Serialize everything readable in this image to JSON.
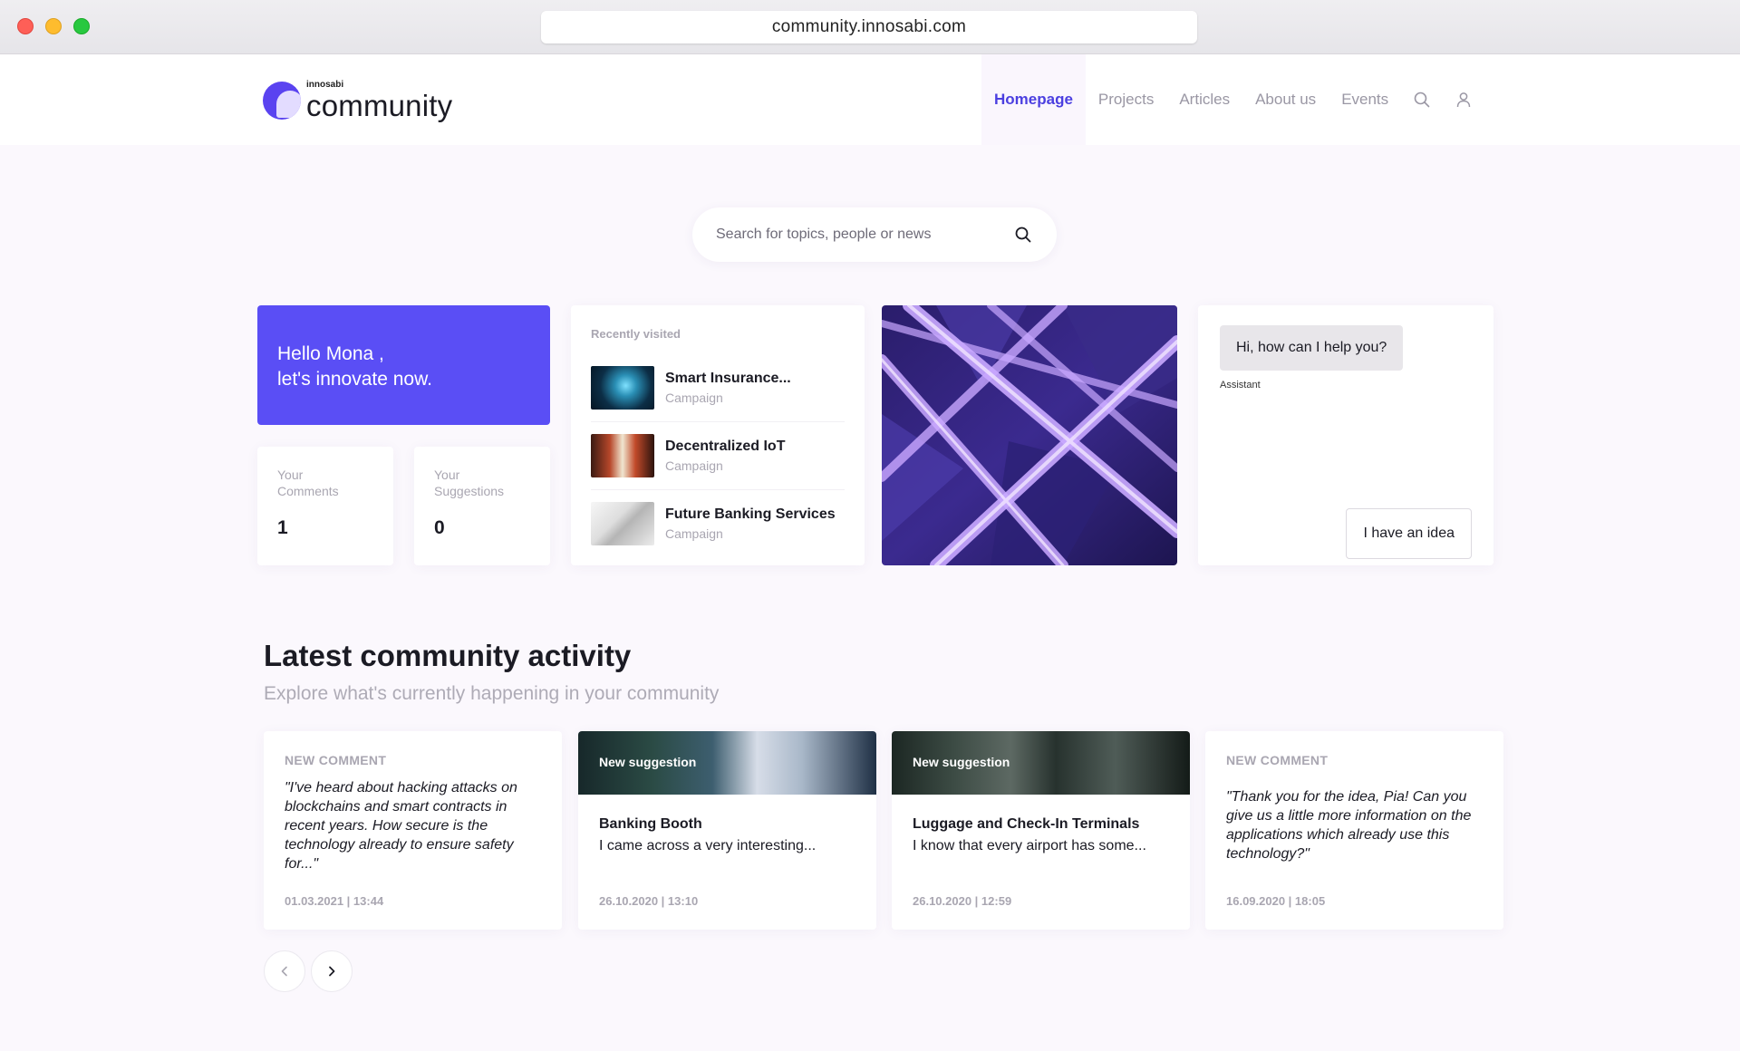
{
  "browser": {
    "url": "community.innosabi.com"
  },
  "brand": {
    "small": "innosabi",
    "name": "community"
  },
  "nav": {
    "items": [
      "Homepage",
      "Projects",
      "Articles",
      "About us",
      "Events"
    ],
    "active": "Homepage"
  },
  "search": {
    "placeholder": "Search for topics, people or news"
  },
  "greeting": {
    "line1": "Hello Mona ,",
    "line2": "let's innovate now."
  },
  "stats": [
    {
      "label": "Your Comments",
      "value": "1"
    },
    {
      "label": "Your Suggestions",
      "value": "0"
    }
  ],
  "recent": {
    "title": "Recently visited",
    "items": [
      {
        "name": "Smart Insurance...",
        "type": "Campaign"
      },
      {
        "name": "Decentralized IoT",
        "type": "Campaign"
      },
      {
        "name": "Future Banking Services",
        "type": "Campaign"
      }
    ]
  },
  "assistant": {
    "message": "Hi, how can I help you?",
    "sender": "Assistant",
    "button": "I have an idea"
  },
  "activity": {
    "title": "Latest community activity",
    "subtitle": "Explore what's currently happening in your community",
    "cards": [
      {
        "tag": "NEW COMMENT",
        "text": "\"I've heard about hacking attacks on blockchains and smart contracts in recent years. How secure is the technology already to ensure safety for...\"",
        "date": "01.03.2021 | 13:44"
      },
      {
        "tag": "New suggestion",
        "title": "Banking Booth",
        "text": "I came across a very interesting...",
        "date": "26.10.2020 | 13:10"
      },
      {
        "tag": "New suggestion",
        "title": "Luggage and Check-In Terminals",
        "text": "I know that every airport has some...",
        "date": "26.10.2020 | 12:59"
      },
      {
        "tag": "NEW COMMENT",
        "text": "\"Thank you for the idea, Pia! Can you give us a little more information on the applications which already use this technology?\"",
        "date": "16.09.2020 | 18:05"
      }
    ]
  },
  "colors": {
    "accent": "#5a4ef5",
    "nav_active": "#4b3fe0",
    "background": "#fbf8fd"
  },
  "icons": [
    "search-icon",
    "user-icon",
    "chevron-left-icon",
    "chevron-right-icon"
  ]
}
